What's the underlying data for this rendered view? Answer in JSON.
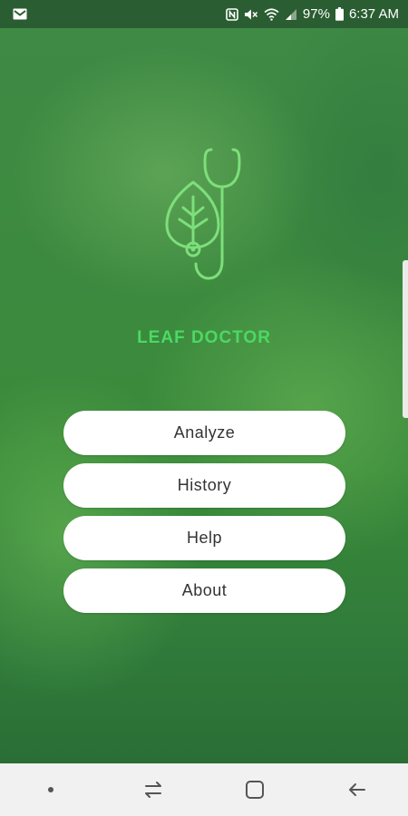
{
  "status_bar": {
    "battery_percent": "97%",
    "time": "6:37 AM"
  },
  "app": {
    "title": "LEAF DOCTOR",
    "title_color": "#4cd964"
  },
  "menu": {
    "buttons": [
      {
        "label": "Analyze"
      },
      {
        "label": "History"
      },
      {
        "label": "Help"
      },
      {
        "label": "About"
      }
    ]
  },
  "icons": {
    "status_left": "gmail-notification-icon",
    "status_right": [
      "nfc-icon",
      "mute-icon",
      "wifi-icon",
      "signal-icon",
      "battery-icon"
    ],
    "logo": "leaf-stethoscope-icon",
    "nav": [
      "dot-icon",
      "recents-icon",
      "home-icon",
      "back-icon"
    ]
  }
}
